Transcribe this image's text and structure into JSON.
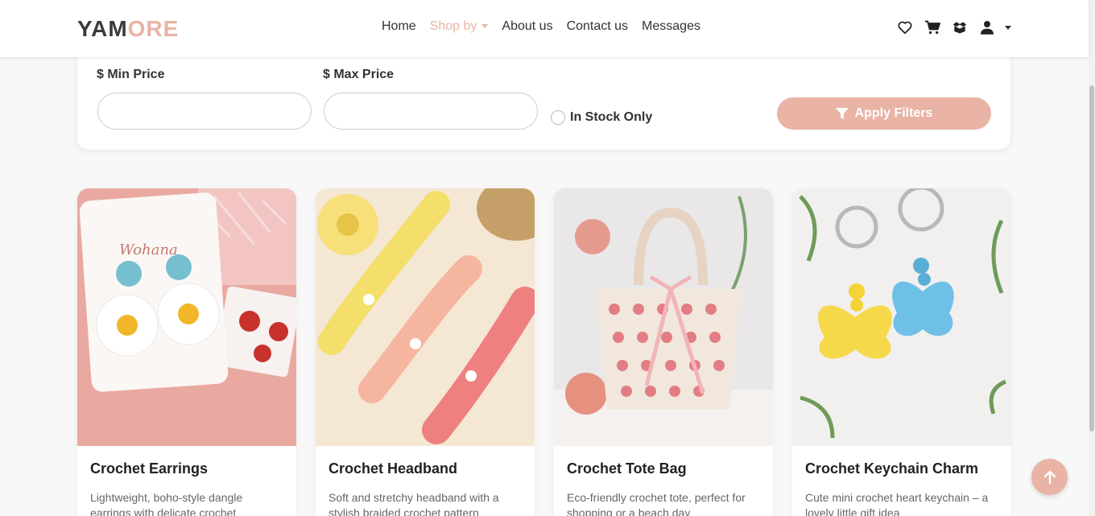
{
  "brand": {
    "part1": "YAM",
    "part2": "ORE"
  },
  "nav": {
    "home": "Home",
    "shop_by": "Shop by",
    "about": "About us",
    "contact": "Contact us",
    "messages": "Messages"
  },
  "icons": [
    "heart-icon",
    "cart-icon",
    "box-icon",
    "user-icon"
  ],
  "filters": {
    "min_price_label": "$ Min Price",
    "max_price_label": "$ Max Price",
    "min_price_value": "",
    "max_price_value": "",
    "in_stock_label": "In Stock Only",
    "apply_label": "Apply Filters"
  },
  "products": [
    {
      "title": "Crochet Earrings",
      "desc": "Lightweight, boho-style dangle earrings with delicate crochet"
    },
    {
      "title": "Crochet Headband",
      "desc": "Soft and stretchy headband with a stylish braided crochet pattern"
    },
    {
      "title": "Crochet Tote Bag",
      "desc": "Eco-friendly crochet tote, perfect for shopping or a beach day"
    },
    {
      "title": "Crochet Keychain Charm",
      "desc": "Cute mini crochet heart keychain – a lovely little gift idea"
    }
  ],
  "colors": {
    "accent": "#e9b3a5",
    "text": "#333333"
  }
}
